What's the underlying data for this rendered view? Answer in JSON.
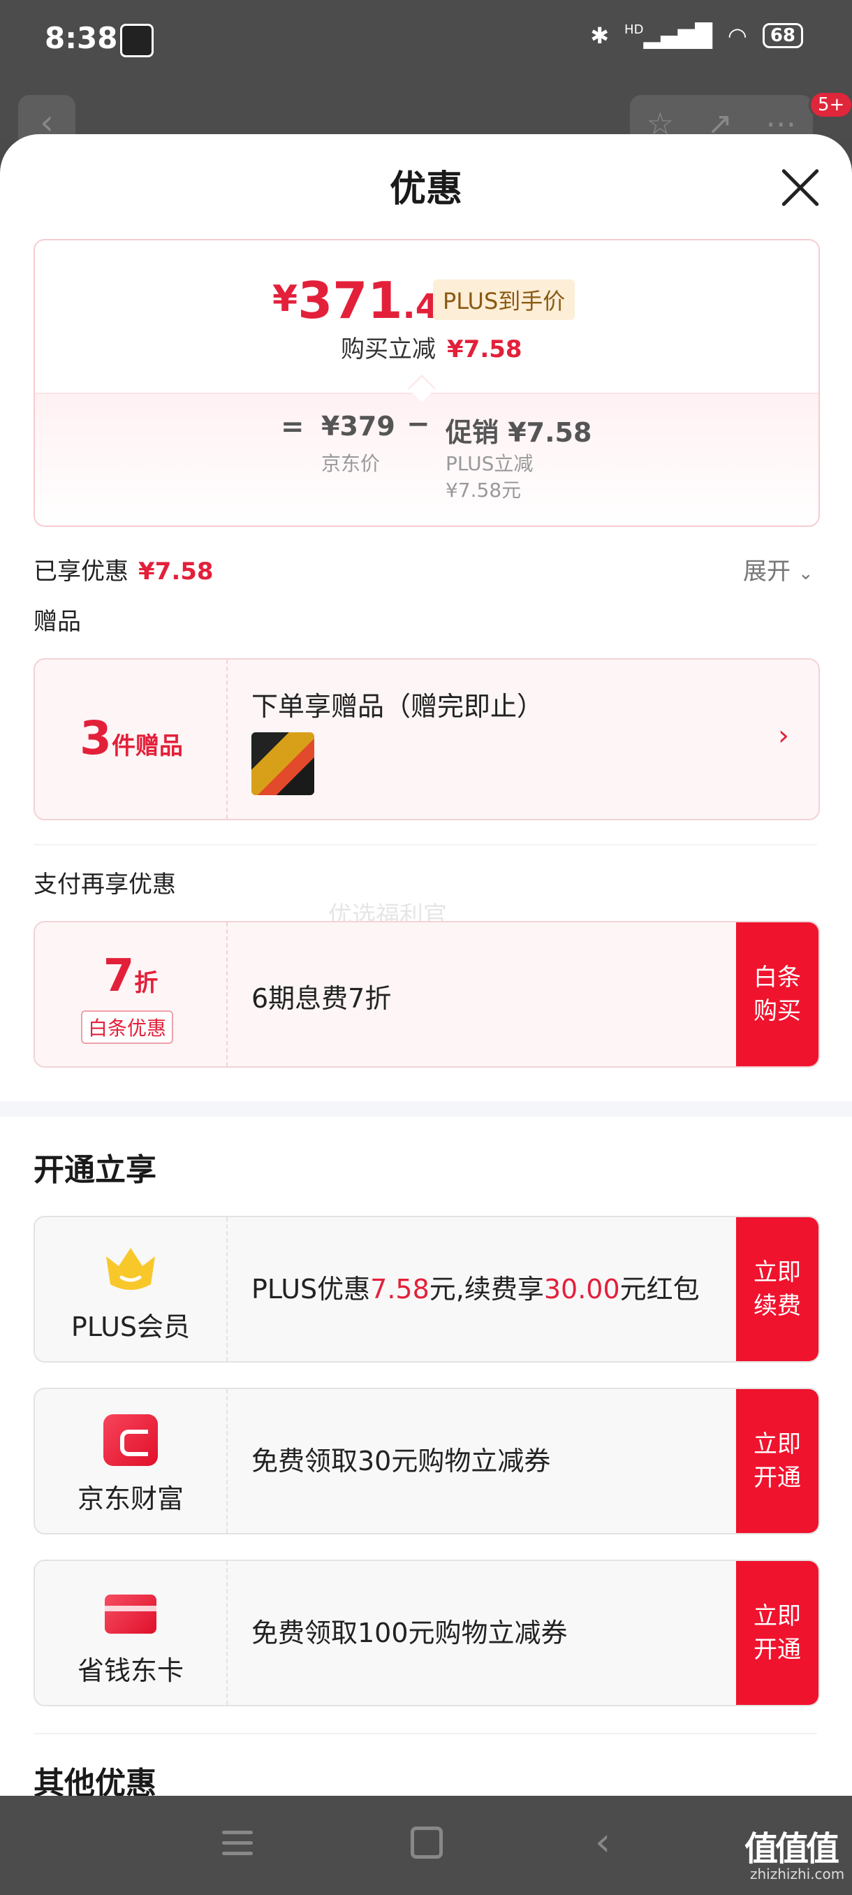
{
  "status_bar": {
    "time": "8:38",
    "battery": "68",
    "network": "HD"
  },
  "background_page": {
    "badge": "5+"
  },
  "sheet": {
    "title": "优惠",
    "price": {
      "currency": "¥",
      "integer": "371",
      "decimal": ".42",
      "tag": "PLUS到手价",
      "subtitle": "购买立减",
      "subtitle_value": "¥7.58"
    },
    "breakdown": {
      "equals": "=",
      "jd_price": "¥379",
      "jd_label": "京东价",
      "minus": "−",
      "promo": "促销 ¥7.58",
      "plus_label": "PLUS立减",
      "plus_value": "¥7.58元"
    },
    "enjoyed": {
      "label": "已享优惠",
      "value": "¥7.58",
      "expand": "展开"
    },
    "gifts": {
      "section_label": "赠品",
      "count": "3",
      "count_unit": "件赠品",
      "title": "下单享赠品（赠完即止）"
    },
    "pay": {
      "section_label": "支付再享优惠",
      "watermark": "优选福利官",
      "discount": "7",
      "discount_unit": "折",
      "tag": "白条优惠",
      "text": "6期息费7折",
      "button": "白条购买"
    },
    "open": {
      "title": "开通立享",
      "plus": {
        "name": "PLUS会员",
        "text_a": "PLUS优惠",
        "value_a": "7.58",
        "text_b": "元,续费享",
        "value_b": "30.00",
        "text_c": "元红包",
        "button": "立即续费"
      },
      "jd_wealth": {
        "name": "京东财富",
        "text": "免费领取30元购物立减券",
        "button": "立即开通"
      },
      "saver_card": {
        "name": "省钱东卡",
        "text": "免费领取100元购物立减券",
        "button": "立即开通"
      }
    },
    "other_title": "其他优惠"
  },
  "watermark_logo": {
    "main": "值值值",
    "sub": "zhizhizhi.com"
  },
  "colors": {
    "accent": "#e3203a",
    "button": "#f0132e",
    "gold": "#8a5a14"
  }
}
